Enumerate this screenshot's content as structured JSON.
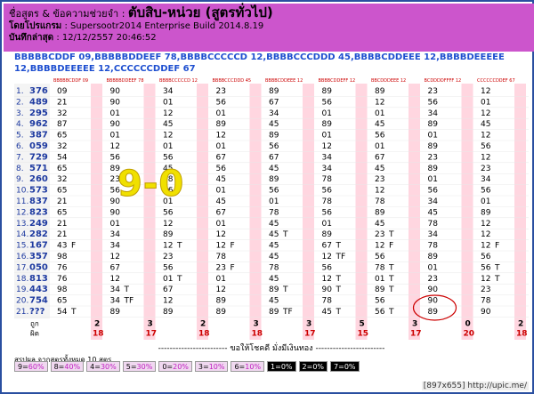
{
  "header": {
    "label_prefix": "ชื่อสูตร & ข้อความช่วยจำ :",
    "title": "ตับสิบ-หน่วย (สูตรทั่วไป)",
    "program_label": "โดยโปรแกรม",
    "program_value": ": Supersootr2014 Enterprise Build 2014.8.19",
    "saved_label": "บันทึกล่าสุด",
    "saved_value": ": 12/12/2557 20:46:52"
  },
  "formula_text": "BBBBBCDDF 09,BBBBBDDEEF 78,BBBBCCCCCD 12,BBBBCCCDDD 45,BBBBCDDEEE 12,BBBBDEEEEE 12,BBBBDEEEEE 12,CCCCCCDDEF 67",
  "col_headers": [
    "BBBBBCDDF 09",
    "BBBBBDDEEF 78",
    "BBBBCCCCCD 12",
    "BBBBCCCDDD 45",
    "BBBBCDDEEE 12",
    "BBBBCDDEFF 12",
    "BBCDDDEEE 12",
    "BCDDDDFFFF 12",
    "CCCCCCDDEF 67"
  ],
  "rows": [
    {
      "n": "1.",
      "id": "376",
      "c": [
        "09",
        "90",
        "34",
        "23",
        "89",
        "89",
        "89",
        "23",
        "12"
      ]
    },
    {
      "n": "2.",
      "id": "489",
      "c": [
        "21",
        "90",
        "01",
        "56",
        "67",
        "56",
        "12",
        "56",
        "01"
      ]
    },
    {
      "n": "3.",
      "id": "295",
      "c": [
        "32",
        "01",
        "12",
        "01",
        "34",
        "01",
        "01",
        "34",
        "12"
      ]
    },
    {
      "n": "4.",
      "id": "962",
      "c": [
        "87",
        "90",
        "45",
        "89",
        "45",
        "89",
        "45",
        "89",
        "45"
      ]
    },
    {
      "n": "5.",
      "id": "387",
      "c": [
        "65",
        "01",
        "12",
        "12",
        "89",
        "01",
        "56",
        "01",
        "12"
      ]
    },
    {
      "n": "6.",
      "id": "059",
      "c": [
        "32",
        "12",
        "01",
        "01",
        "56",
        "12",
        "01",
        "89",
        "56"
      ]
    },
    {
      "n": "7.",
      "id": "729",
      "c": [
        "54",
        "56",
        "56",
        "67",
        "67",
        "34",
        "67",
        "23",
        "12"
      ]
    },
    {
      "n": "8.",
      "id": "571",
      "c": [
        "65",
        "89",
        "45",
        "56",
        "45",
        "34",
        "45",
        "89",
        "23"
      ]
    },
    {
      "n": "9.",
      "id": "260",
      "c": [
        "32",
        "23",
        "78",
        "45",
        "89",
        "78",
        "23",
        "01",
        "34"
      ]
    },
    {
      "n": "10.",
      "id": "573",
      "c": [
        "65",
        "56",
        "56",
        "01",
        "56",
        "56",
        "12",
        "56",
        "56"
      ]
    },
    {
      "n": "11.",
      "id": "837",
      "c": [
        "21",
        "90",
        "01",
        "45",
        "01",
        "78",
        "78",
        "34",
        "01"
      ]
    },
    {
      "n": "12.",
      "id": "823",
      "c": [
        "65",
        "90",
        "56",
        "67",
        "78",
        "56",
        "89",
        "45",
        "89"
      ]
    },
    {
      "n": "13.",
      "id": "249",
      "c": [
        "21",
        "01",
        "12",
        "01",
        "45",
        "01",
        "45",
        "78",
        "12"
      ]
    },
    {
      "n": "14.",
      "id": "282",
      "c": [
        "21",
        "34",
        "89",
        "12",
        "45",
        "89",
        "23",
        "34",
        "12"
      ]
    },
    {
      "n": "15.",
      "id": "167",
      "c": [
        "43",
        "34",
        "12",
        "12",
        "45",
        "67",
        "12",
        "78",
        "12"
      ]
    },
    {
      "n": "16.",
      "id": "357",
      "c": [
        "98",
        "12",
        "23",
        "78",
        "45",
        "12",
        "56",
        "89",
        "56"
      ]
    },
    {
      "n": "17.",
      "id": "050",
      "c": [
        "76",
        "67",
        "56",
        "23",
        "78",
        "56",
        "78",
        "01",
        "56"
      ]
    },
    {
      "n": "18.",
      "id": "813",
      "c": [
        "76",
        "12",
        "01",
        "01",
        "45",
        "12",
        "01",
        "23",
        "12"
      ]
    },
    {
      "n": "19.",
      "id": "443",
      "c": [
        "98",
        "34",
        "67",
        "12",
        "89",
        "90",
        "89",
        "90",
        "23"
      ]
    },
    {
      "n": "20.",
      "id": "754",
      "c": [
        "65",
        "34",
        "12",
        "89",
        "45",
        "78",
        "56",
        "90",
        "78"
      ]
    },
    {
      "n": "21.",
      "id": "???",
      "c": [
        "54",
        "89",
        "89",
        "89",
        "89",
        "45",
        "56",
        "89",
        "90"
      ]
    }
  ],
  "marks": [
    {
      "r": 13,
      "k": 4,
      "t": "T"
    },
    {
      "r": 13,
      "k": 6,
      "t": "T"
    },
    {
      "r": 14,
      "k": 0,
      "t": "F"
    },
    {
      "r": 14,
      "k": 2,
      "t": "T"
    },
    {
      "r": 14,
      "k": 3,
      "t": "F"
    },
    {
      "r": 14,
      "k": 5,
      "t": "T"
    },
    {
      "r": 14,
      "k": 6,
      "t": "F"
    },
    {
      "r": 14,
      "k": 8,
      "t": "F"
    },
    {
      "r": 15,
      "k": 5,
      "t": "TF"
    },
    {
      "r": 16,
      "k": 3,
      "t": "F"
    },
    {
      "r": 16,
      "k": 6,
      "t": "T"
    },
    {
      "r": 16,
      "k": 8,
      "t": "T"
    },
    {
      "r": 17,
      "k": 2,
      "t": "T"
    },
    {
      "r": 17,
      "k": 5,
      "t": "T"
    },
    {
      "r": 17,
      "k": 6,
      "t": "T"
    },
    {
      "r": 17,
      "k": 8,
      "t": "T"
    },
    {
      "r": 18,
      "k": 1,
      "t": "T"
    },
    {
      "r": 18,
      "k": 4,
      "t": "T"
    },
    {
      "r": 18,
      "k": 5,
      "t": "T"
    },
    {
      "r": 18,
      "k": 6,
      "t": "T"
    },
    {
      "r": 19,
      "k": 1,
      "t": "TF"
    },
    {
      "r": 20,
      "k": 0,
      "t": "T"
    },
    {
      "r": 20,
      "k": 4,
      "t": "TF"
    },
    {
      "r": 20,
      "k": 5,
      "t": "T"
    },
    {
      "r": 20,
      "k": 6,
      "t": "T"
    }
  ],
  "hit_label": "ถูก",
  "miss_label": "ผิด",
  "hits": [
    "2",
    "3",
    "2",
    "3",
    "3",
    "5",
    "3",
    "0",
    "2"
  ],
  "misses": [
    "18",
    "17",
    "18",
    "18",
    "17",
    "15",
    "17",
    "20",
    "18"
  ],
  "score_text": "9-0",
  "footer_line": "------------------------ ขอให้โชคดี มั่งมีเงินทอง ------------------------",
  "summary_title": "สรุปผล จากสูตรทั้งหมด 10 สูตร",
  "summary": [
    {
      "label": "9=",
      "pct": "60%",
      "style": "light"
    },
    {
      "label": "8=",
      "pct": "40%",
      "style": "light"
    },
    {
      "label": "4=",
      "pct": "30%",
      "style": "light"
    },
    {
      "label": "5=",
      "pct": "30%",
      "style": "light"
    },
    {
      "label": "0=",
      "pct": "20%",
      "style": "light"
    },
    {
      "label": "3=",
      "pct": "10%",
      "style": "light"
    },
    {
      "label": "6=",
      "pct": "10%",
      "style": "light"
    },
    {
      "label": "1=",
      "pct": "0%",
      "style": "dark"
    },
    {
      "label": "2=",
      "pct": "0%",
      "style": "dark"
    },
    {
      "label": "7=",
      "pct": "0%",
      "style": "dark"
    }
  ],
  "watermark": "[897x655] http://upic.me/",
  "colors": {
    "header_bg": "#cc55cc",
    "pink_col": "#ffd6e0",
    "id_blue": "#1e3aa0",
    "formula_blue": "#1e4fd0",
    "mark_purple": "#c020c0",
    "mark_blue": "#1030b0",
    "score_red": "#cc0000"
  }
}
